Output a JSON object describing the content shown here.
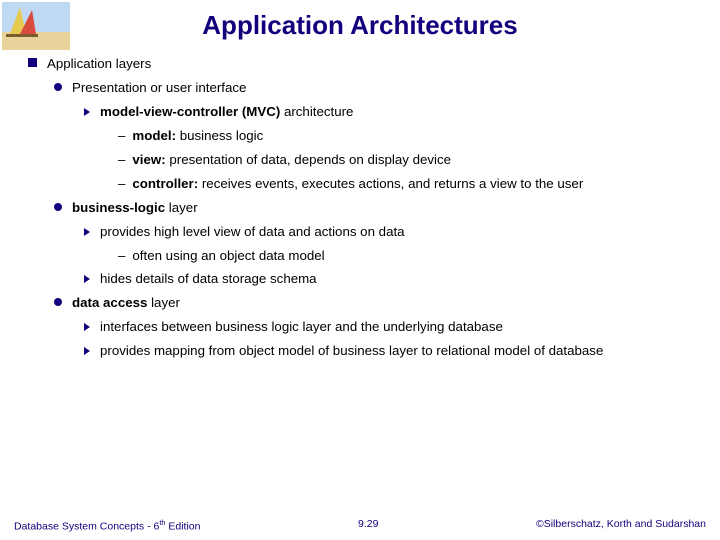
{
  "title": "Application Architectures",
  "l1": {
    "a": "Application layers"
  },
  "l2": {
    "a": "Presentation or user interface",
    "b_prefix": "business-logic",
    "b_suffix": " layer",
    "c_prefix": "data access",
    "c_suffix": " layer"
  },
  "l3": {
    "a_prefix": "model-view-controller (MVC)",
    "a_suffix": " architecture",
    "b": "provides high level view of data and actions on data",
    "c": "hides details of data storage schema",
    "d": "interfaces between business logic layer and the underlying database",
    "e": "provides mapping from object model of business layer to relational model of database"
  },
  "l4": {
    "a_prefix": "model:",
    "a_suffix": " business logic",
    "b_prefix": "view:",
    "b_suffix": " presentation of data, depends on display device",
    "c_prefix": "controller:",
    "c_suffix": " receives events, executes actions, and returns a view to the user",
    "d": "often using an object data model"
  },
  "footer": {
    "left_a": "Database System Concepts - 6",
    "left_b": " Edition",
    "sup": "th",
    "center": "9.29",
    "right": "©Silberschatz, Korth and Sudarshan"
  }
}
